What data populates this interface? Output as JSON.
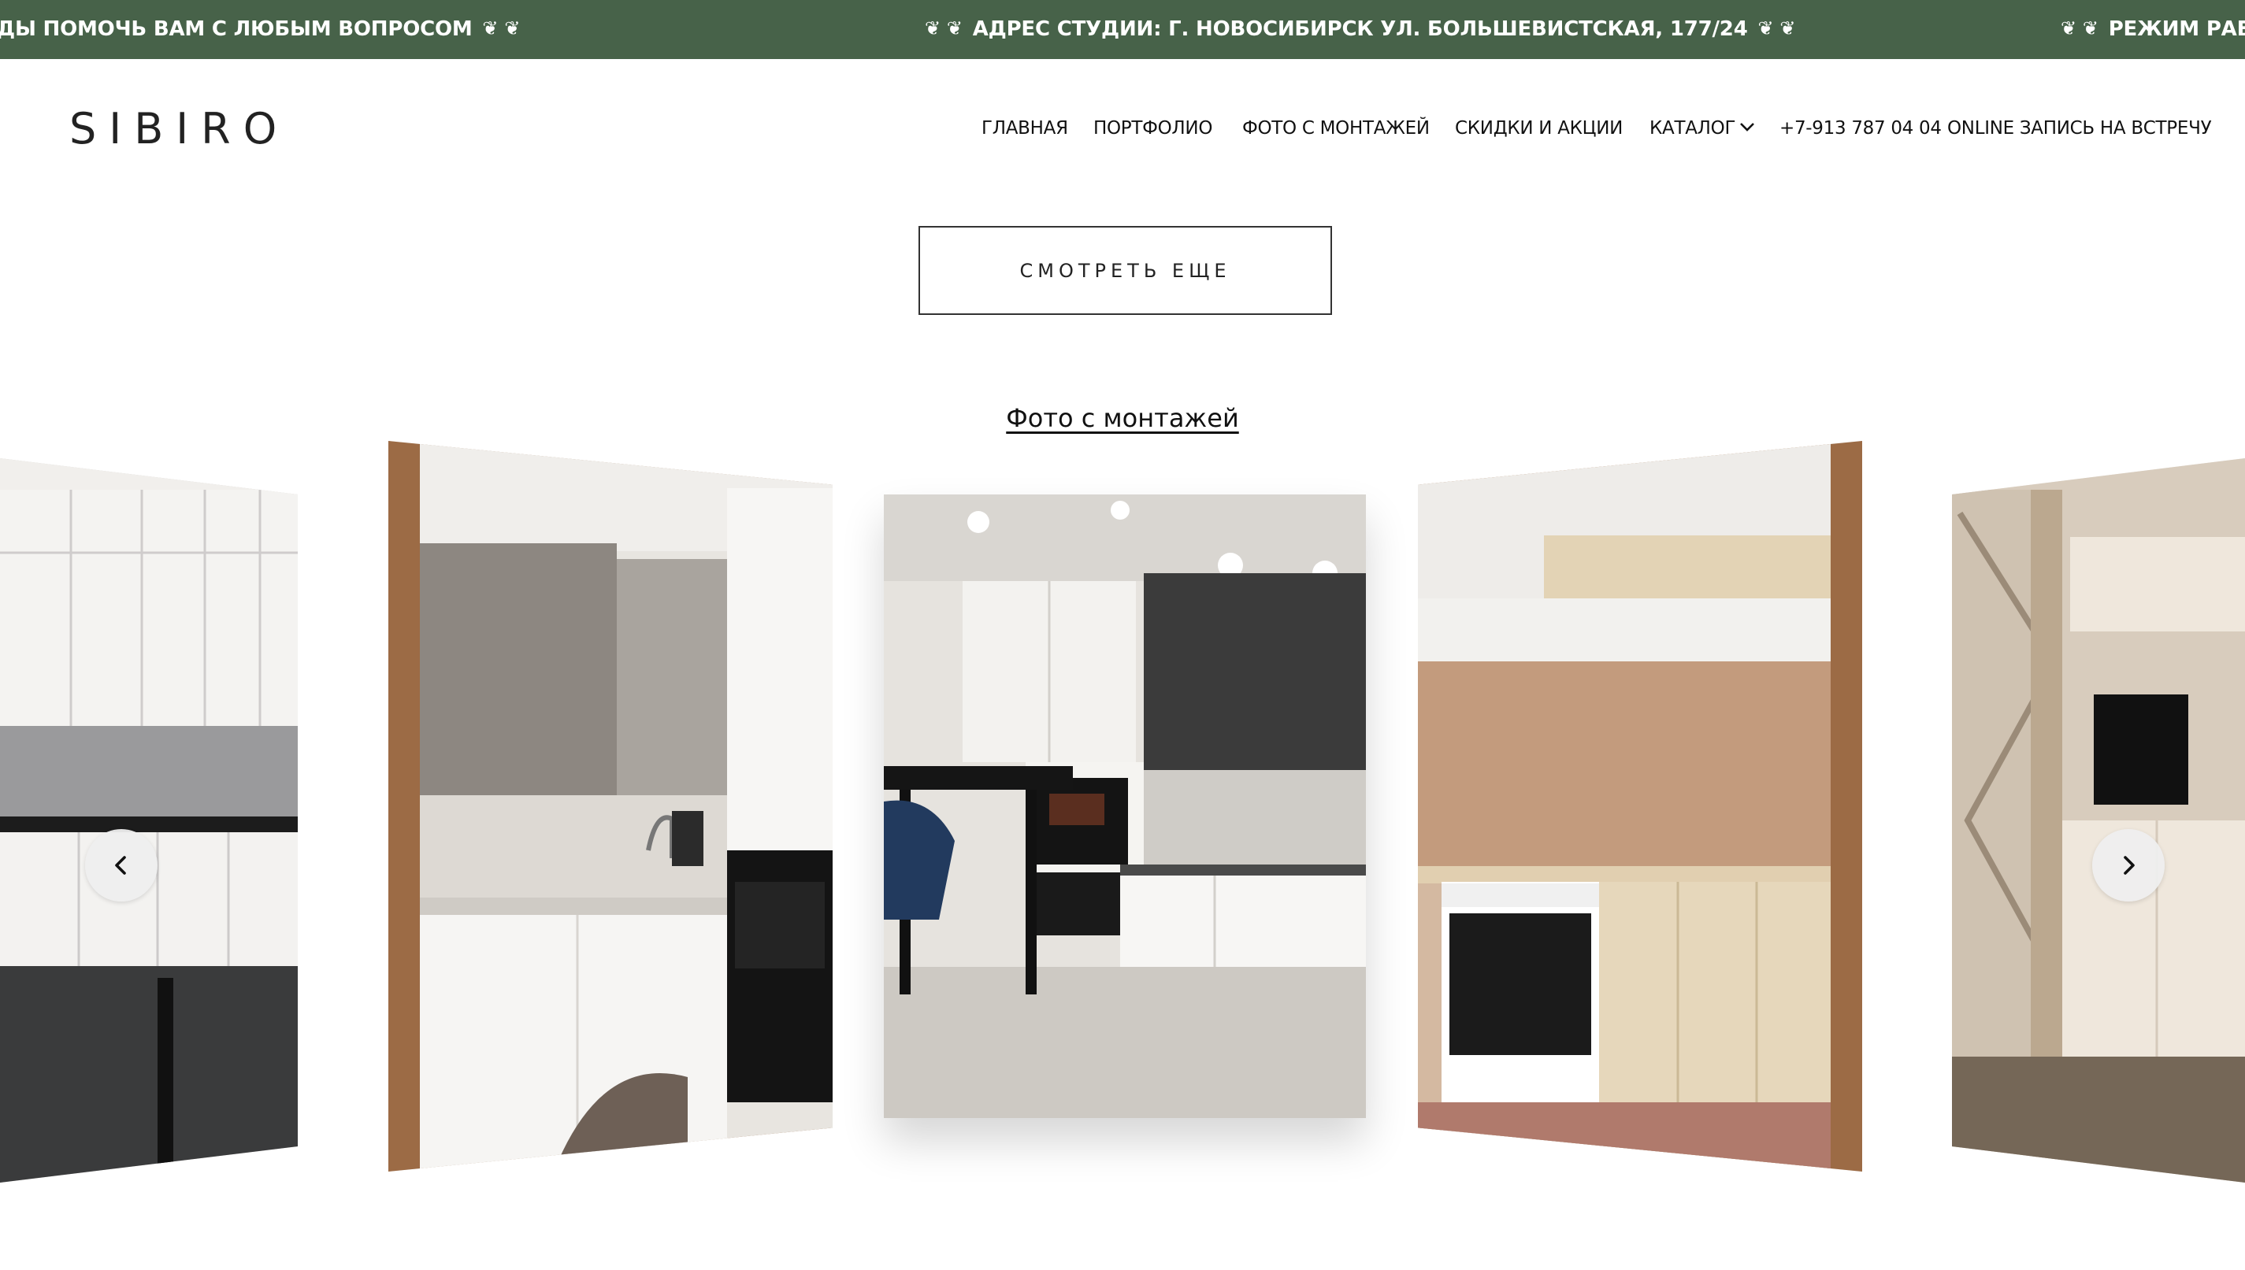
{
  "marquee": {
    "items": [
      {
        "text": "ДЫ ПОМОЧЬ ВАМ С ЛЮБЫМ ВОПРОСОМ",
        "icon": "leaf-icon"
      },
      {
        "text": "АДРЕС СТУДИИ: Г. НОВОСИБИРСК УЛ. БОЛЬШЕВИСТСКАЯ, 177/24",
        "icon": "leaf-icon"
      },
      {
        "text": "РЕЖИМ РАБО",
        "icon": "leaf-icon"
      }
    ],
    "leaf_glyph": "❦"
  },
  "header": {
    "logo": "SIBIRO",
    "nav": [
      {
        "label": "ГЛАВНАЯ"
      },
      {
        "label": "ПОРТФОЛИО"
      },
      {
        "label": "ФОТО С МОНТАЖЕЙ"
      },
      {
        "label": "СКИДКИ И АКЦИИ"
      },
      {
        "label": "КАТАЛОГ",
        "icon": "chevron-down-icon"
      },
      {
        "label": "+7-913 787 04 04"
      },
      {
        "label": "ONLINE ЗАПИСЬ НА ВСТРЕЧУ"
      }
    ]
  },
  "main": {
    "more_button": "СМОТРЕТЬ ЕЩЕ",
    "section_link": "Фото с монтажей",
    "carousel": {
      "slides": [
        {
          "name": "white-kitchen-slide"
        },
        {
          "name": "glossy-kitchen-slide"
        },
        {
          "name": "dark-accent-kitchen-slide"
        },
        {
          "name": "beige-kitchen-slide"
        },
        {
          "name": "wardrobe-living-slide"
        }
      ],
      "prev_icon": "chevron-left-icon",
      "next_icon": "chevron-right-icon"
    }
  },
  "colors": {
    "marquee_bg": "#476249",
    "marquee_text": "#ffffff",
    "page_bg": "#ffffff",
    "wood_frame": "#9c6b45"
  }
}
